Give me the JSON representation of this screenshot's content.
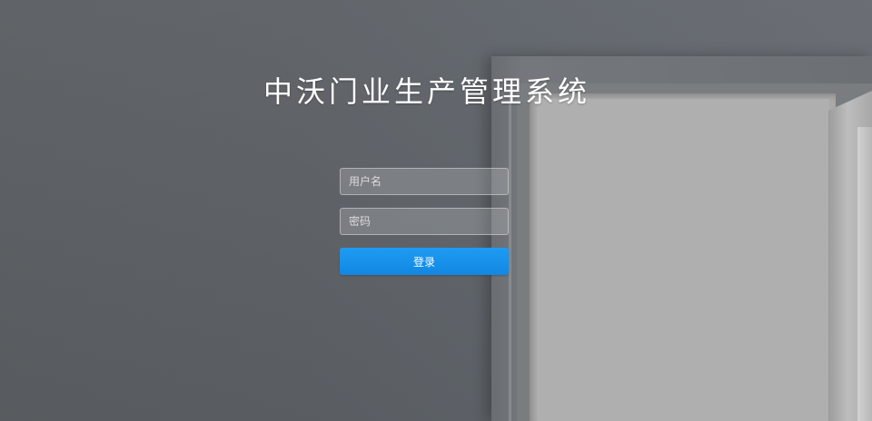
{
  "page": {
    "title": "中沃门业生产管理系统"
  },
  "login": {
    "username_placeholder": "用户名",
    "username_value": "",
    "password_placeholder": "密码",
    "password_value": "",
    "submit_label": "登录"
  },
  "colors": {
    "background": "#5d6166",
    "button": "#1890ea",
    "title_text": "#ffffff"
  }
}
